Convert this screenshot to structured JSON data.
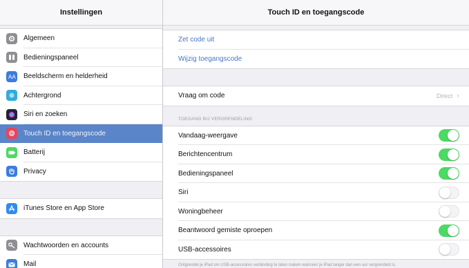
{
  "sidebar": {
    "title": "Instellingen",
    "groups": [
      [
        {
          "label": "Algemeen",
          "icon": "gear-icon",
          "color": "#8e8e93"
        },
        {
          "label": "Bedieningspaneel",
          "icon": "control-center-icon",
          "color": "#8e8e93"
        },
        {
          "label": "Beeldscherm en helderheid",
          "icon": "display-icon",
          "color": "#3b7ddd"
        },
        {
          "label": "Achtergrond",
          "icon": "wallpaper-icon",
          "color": "#35aadc"
        },
        {
          "label": "Siri en zoeken",
          "icon": "siri-icon",
          "color": "#222233"
        },
        {
          "label": "Touch ID en toegangscode",
          "icon": "touch-id-icon",
          "color": "#e9445a",
          "selected": true
        },
        {
          "label": "Batterij",
          "icon": "battery-icon",
          "color": "#4cd964"
        },
        {
          "label": "Privacy",
          "icon": "privacy-hand-icon",
          "color": "#3b7ddd"
        }
      ],
      [
        {
          "label": "iTunes Store en App Store",
          "icon": "app-store-icon",
          "color": "#2f8cf0"
        }
      ],
      [
        {
          "label": "Wachtwoorden en accounts",
          "icon": "key-icon",
          "color": "#8e8e93"
        },
        {
          "label": "Mail",
          "icon": "mail-icon",
          "color": "#3b7ddd"
        }
      ]
    ]
  },
  "main": {
    "title": "Touch ID en toegangscode",
    "code_group": [
      {
        "label": "Zet code uit"
      },
      {
        "label": "Wijzig toegangscode"
      }
    ],
    "ask_code": {
      "label": "Vraag om code",
      "value": "Direct"
    },
    "section_header": "TOEGANG BIJ VERGRENDELING:",
    "toggles": [
      {
        "label": "Vandaag-weergave",
        "on": true
      },
      {
        "label": "Berichtencentrum",
        "on": true
      },
      {
        "label": "Bedieningspaneel",
        "on": true
      },
      {
        "label": "Siri",
        "on": false
      },
      {
        "label": "Woningbeheer",
        "on": false
      },
      {
        "label": "Beantwoord gemiste oproepen",
        "on": true
      },
      {
        "label": "USB-accessoires",
        "on": false
      }
    ],
    "footer": "Ontgrendel je iPad om USB-accessoires verbinding te laten maken wanneer je iPad langer dan een uur vergrendeld is."
  }
}
